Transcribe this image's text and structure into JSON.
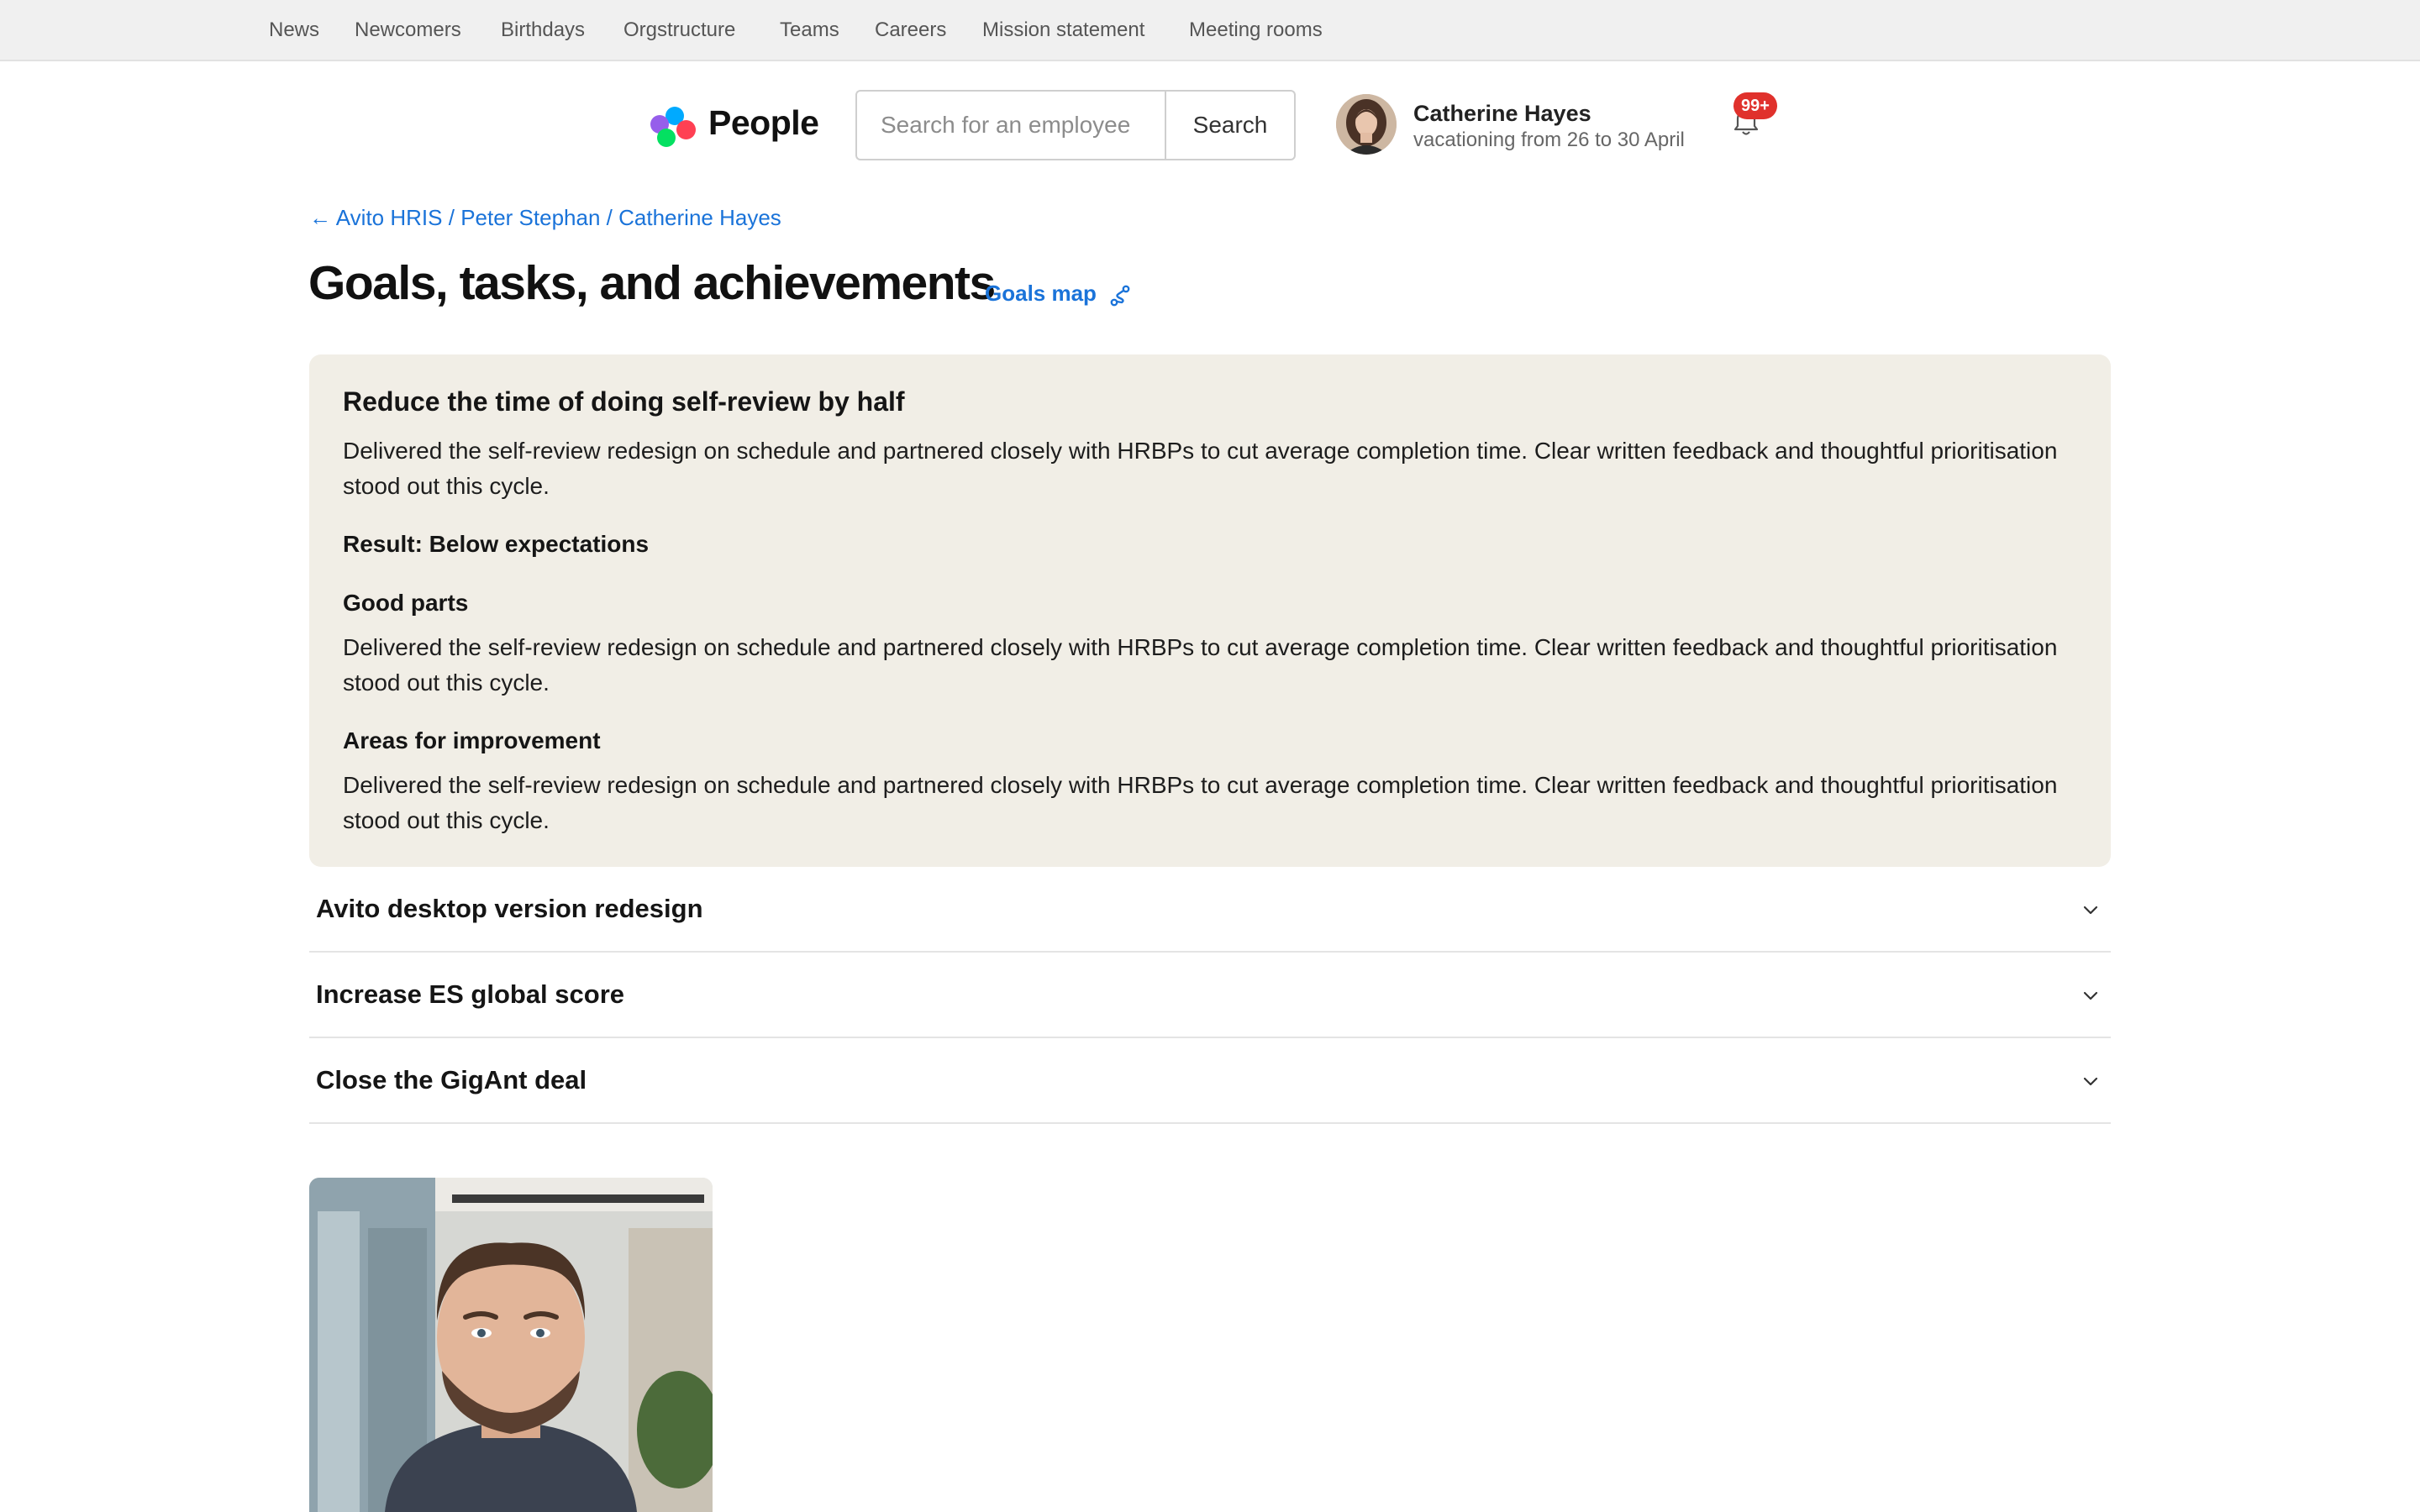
{
  "topnav": {
    "items": [
      {
        "label": "News"
      },
      {
        "label": "Newcomers"
      },
      {
        "label": "Birthdays"
      },
      {
        "label": "Orgstructure"
      },
      {
        "label": "Teams"
      },
      {
        "label": "Careers"
      },
      {
        "label": "Mission statement"
      },
      {
        "label": "Meeting rooms"
      }
    ]
  },
  "header": {
    "logo_text": "People",
    "search_placeholder": "Search for an employee",
    "search_button": "Search",
    "user_name": "Catherine Hayes",
    "user_status": "vacationing from 26 to 30 April",
    "notifications_badge": "99+"
  },
  "breadcrumb": {
    "arrow": "←",
    "items": [
      "Avito HRIS",
      "Peter Stephan",
      "Catherine Hayes"
    ],
    "separator": "/"
  },
  "page": {
    "title": "Goals, tasks, and achievements",
    "goals_map_link": "Goals map"
  },
  "expanded_goal": {
    "title": "Reduce the time of doing self-review by half",
    "summary": "Delivered the self-review redesign on schedule and partnered closely with HRBPs to cut average completion time. Clear written feedback and thoughtful prioritisation stood out this cycle.",
    "result": "Result: Below expectations",
    "good_parts_heading": "Good parts",
    "good_parts_text": "Delivered the self-review redesign on schedule and partnered closely with HRBPs to cut average completion time. Clear written feedback and thoughtful prioritisation stood out this cycle.",
    "improvement_heading": "Areas for improvement",
    "improvement_text": "Delivered the self-review redesign on schedule and partnered closely with HRBPs to cut average completion time. Clear written feedback and thoughtful prioritisation stood out this cycle."
  },
  "collapsed_goals": [
    {
      "title": "Avito desktop version redesign"
    },
    {
      "title": "Increase ES global score"
    },
    {
      "title": "Close the GigAnt deal"
    }
  ],
  "colors": {
    "link": "#1a73d9",
    "badge": "#e0312c",
    "card_bg": "#f1eee6",
    "topnav_bg": "#f0f0f0"
  },
  "icons": [
    "people-logo-icon",
    "bell-icon",
    "goals-map-icon",
    "chevron-down-icon",
    "back-arrow-icon"
  ]
}
